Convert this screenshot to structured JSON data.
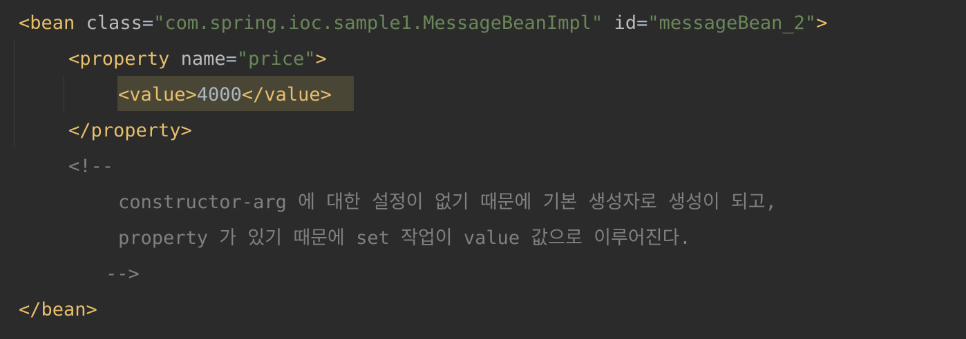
{
  "editor": {
    "line1": {
      "open": "<bean",
      "attr1_name": "class",
      "eq1": "=",
      "attr1_value": "\"com.spring.ioc.sample1.MessageBeanImpl\"",
      "attr2_name": "id",
      "eq2": "=",
      "attr2_value": "\"messageBean_2\"",
      "close": ">"
    },
    "line2": {
      "open": "<property",
      "attr_name": "name",
      "eq": "=",
      "attr_value": "\"price\"",
      "close": ">"
    },
    "line3": {
      "open": "<value>",
      "content": "4000",
      "close": "</value>"
    },
    "line4": {
      "close": "</property>"
    },
    "comment": {
      "open": "<!--",
      "line1": "constructor-arg 에 대한 설정이 없기 때문에 기본 생성자로 생성이 되고,",
      "line2": "property 가 있기 때문에 set 작업이 value 값으로 이루어진다.",
      "close": "-->"
    },
    "last": {
      "close": "</bean>"
    },
    "colors": {
      "background": "#2b2b2b",
      "tag": "#e8bf6a",
      "attribute": "#bababa",
      "string": "#6a8759",
      "comment": "#808080",
      "text": "#a9b7c6",
      "highlight": "#4a4636"
    }
  }
}
